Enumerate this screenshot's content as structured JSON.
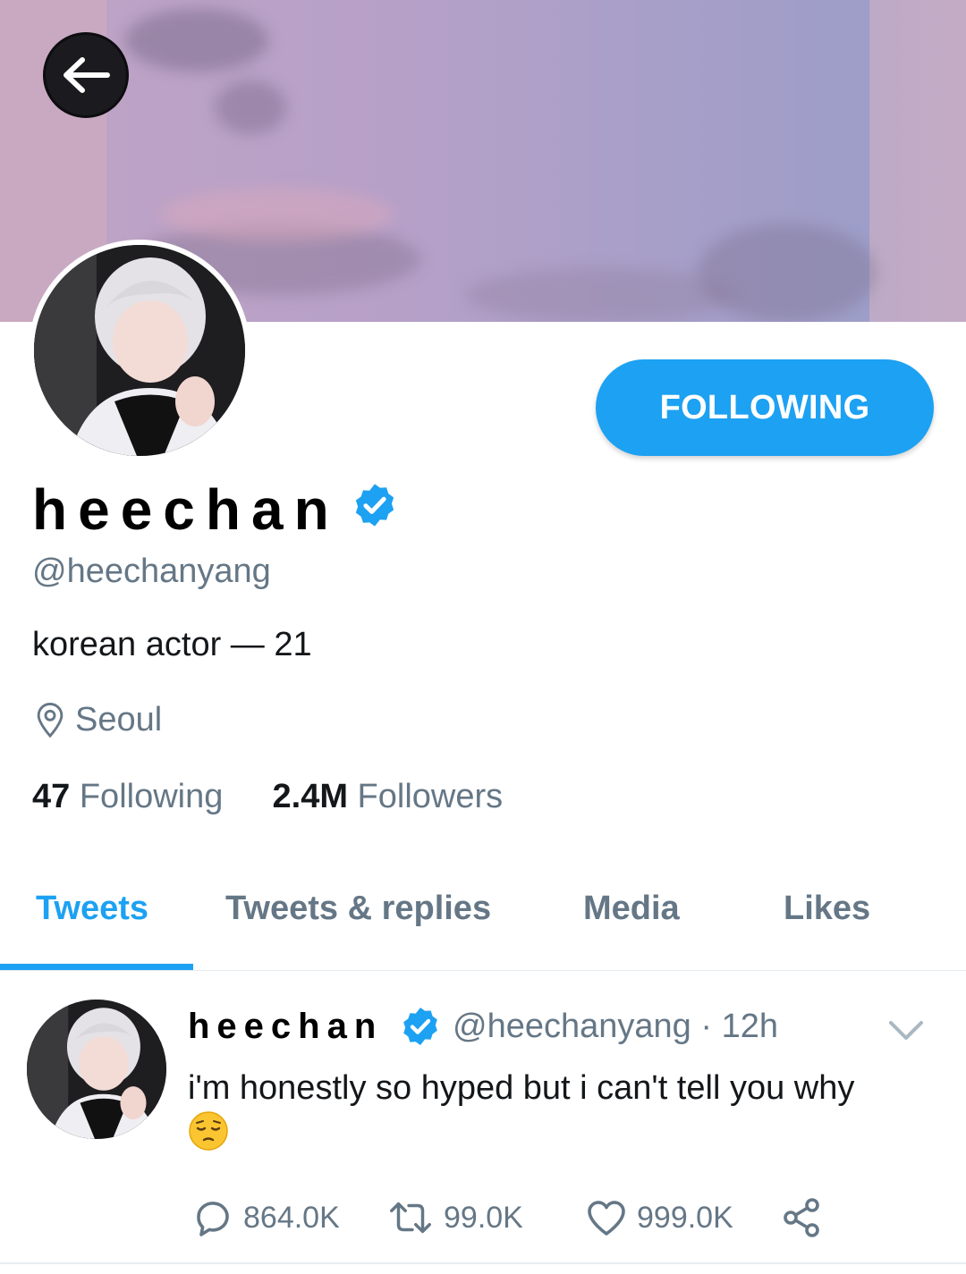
{
  "header": {
    "back_icon": "arrow-left-icon"
  },
  "profile": {
    "display_name": "heechan",
    "handle": "@heechanyang",
    "bio": "korean actor — 21",
    "location": "Seoul",
    "following_count": "47",
    "following_label": "Following",
    "followers_count": "2.4M",
    "followers_label": "Followers",
    "follow_button_label": "FOLLOWING",
    "verified": true
  },
  "tabs": [
    {
      "label": "Tweets",
      "active": true
    },
    {
      "label": "Tweets & replies",
      "active": false
    },
    {
      "label": "Media",
      "active": false
    },
    {
      "label": "Likes",
      "active": false
    }
  ],
  "tweet": {
    "author_name": "heechan",
    "author_handle": "@heechanyang",
    "separator": "·",
    "time": "12h",
    "text": "i'm honestly so hyped but i can't tell you why",
    "emoji": "pensive-face",
    "replies": "864.0K",
    "retweets": "99.0K",
    "likes": "999.0K"
  },
  "colors": {
    "accent": "#1da1f2",
    "secondary_text": "#657786",
    "primary_text": "#14171a"
  }
}
